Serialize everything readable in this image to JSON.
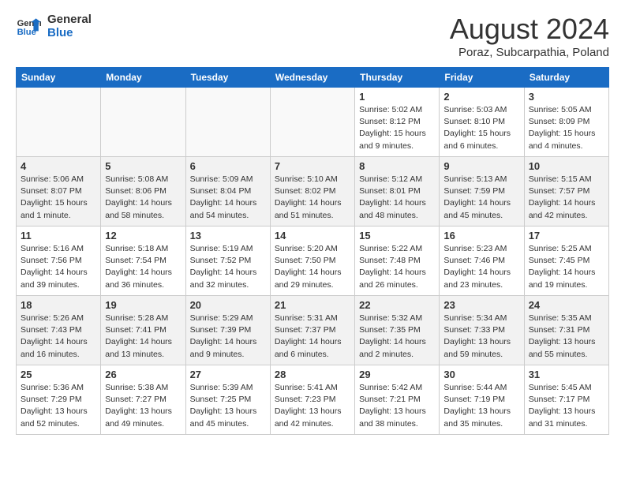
{
  "header": {
    "logo_line1": "General",
    "logo_line2": "Blue",
    "month_year": "August 2024",
    "location": "Poraz, Subcarpathia, Poland"
  },
  "weekdays": [
    "Sunday",
    "Monday",
    "Tuesday",
    "Wednesday",
    "Thursday",
    "Friday",
    "Saturday"
  ],
  "weeks": [
    [
      {
        "num": "",
        "info": ""
      },
      {
        "num": "",
        "info": ""
      },
      {
        "num": "",
        "info": ""
      },
      {
        "num": "",
        "info": ""
      },
      {
        "num": "1",
        "info": "Sunrise: 5:02 AM\nSunset: 8:12 PM\nDaylight: 15 hours and 9 minutes."
      },
      {
        "num": "2",
        "info": "Sunrise: 5:03 AM\nSunset: 8:10 PM\nDaylight: 15 hours and 6 minutes."
      },
      {
        "num": "3",
        "info": "Sunrise: 5:05 AM\nSunset: 8:09 PM\nDaylight: 15 hours and 4 minutes."
      }
    ],
    [
      {
        "num": "4",
        "info": "Sunrise: 5:06 AM\nSunset: 8:07 PM\nDaylight: 15 hours and 1 minute."
      },
      {
        "num": "5",
        "info": "Sunrise: 5:08 AM\nSunset: 8:06 PM\nDaylight: 14 hours and 58 minutes."
      },
      {
        "num": "6",
        "info": "Sunrise: 5:09 AM\nSunset: 8:04 PM\nDaylight: 14 hours and 54 minutes."
      },
      {
        "num": "7",
        "info": "Sunrise: 5:10 AM\nSunset: 8:02 PM\nDaylight: 14 hours and 51 minutes."
      },
      {
        "num": "8",
        "info": "Sunrise: 5:12 AM\nSunset: 8:01 PM\nDaylight: 14 hours and 48 minutes."
      },
      {
        "num": "9",
        "info": "Sunrise: 5:13 AM\nSunset: 7:59 PM\nDaylight: 14 hours and 45 minutes."
      },
      {
        "num": "10",
        "info": "Sunrise: 5:15 AM\nSunset: 7:57 PM\nDaylight: 14 hours and 42 minutes."
      }
    ],
    [
      {
        "num": "11",
        "info": "Sunrise: 5:16 AM\nSunset: 7:56 PM\nDaylight: 14 hours and 39 minutes."
      },
      {
        "num": "12",
        "info": "Sunrise: 5:18 AM\nSunset: 7:54 PM\nDaylight: 14 hours and 36 minutes."
      },
      {
        "num": "13",
        "info": "Sunrise: 5:19 AM\nSunset: 7:52 PM\nDaylight: 14 hours and 32 minutes."
      },
      {
        "num": "14",
        "info": "Sunrise: 5:20 AM\nSunset: 7:50 PM\nDaylight: 14 hours and 29 minutes."
      },
      {
        "num": "15",
        "info": "Sunrise: 5:22 AM\nSunset: 7:48 PM\nDaylight: 14 hours and 26 minutes."
      },
      {
        "num": "16",
        "info": "Sunrise: 5:23 AM\nSunset: 7:46 PM\nDaylight: 14 hours and 23 minutes."
      },
      {
        "num": "17",
        "info": "Sunrise: 5:25 AM\nSunset: 7:45 PM\nDaylight: 14 hours and 19 minutes."
      }
    ],
    [
      {
        "num": "18",
        "info": "Sunrise: 5:26 AM\nSunset: 7:43 PM\nDaylight: 14 hours and 16 minutes."
      },
      {
        "num": "19",
        "info": "Sunrise: 5:28 AM\nSunset: 7:41 PM\nDaylight: 14 hours and 13 minutes."
      },
      {
        "num": "20",
        "info": "Sunrise: 5:29 AM\nSunset: 7:39 PM\nDaylight: 14 hours and 9 minutes."
      },
      {
        "num": "21",
        "info": "Sunrise: 5:31 AM\nSunset: 7:37 PM\nDaylight: 14 hours and 6 minutes."
      },
      {
        "num": "22",
        "info": "Sunrise: 5:32 AM\nSunset: 7:35 PM\nDaylight: 14 hours and 2 minutes."
      },
      {
        "num": "23",
        "info": "Sunrise: 5:34 AM\nSunset: 7:33 PM\nDaylight: 13 hours and 59 minutes."
      },
      {
        "num": "24",
        "info": "Sunrise: 5:35 AM\nSunset: 7:31 PM\nDaylight: 13 hours and 55 minutes."
      }
    ],
    [
      {
        "num": "25",
        "info": "Sunrise: 5:36 AM\nSunset: 7:29 PM\nDaylight: 13 hours and 52 minutes."
      },
      {
        "num": "26",
        "info": "Sunrise: 5:38 AM\nSunset: 7:27 PM\nDaylight: 13 hours and 49 minutes."
      },
      {
        "num": "27",
        "info": "Sunrise: 5:39 AM\nSunset: 7:25 PM\nDaylight: 13 hours and 45 minutes."
      },
      {
        "num": "28",
        "info": "Sunrise: 5:41 AM\nSunset: 7:23 PM\nDaylight: 13 hours and 42 minutes."
      },
      {
        "num": "29",
        "info": "Sunrise: 5:42 AM\nSunset: 7:21 PM\nDaylight: 13 hours and 38 minutes."
      },
      {
        "num": "30",
        "info": "Sunrise: 5:44 AM\nSunset: 7:19 PM\nDaylight: 13 hours and 35 minutes."
      },
      {
        "num": "31",
        "info": "Sunrise: 5:45 AM\nSunset: 7:17 PM\nDaylight: 13 hours and 31 minutes."
      }
    ]
  ]
}
